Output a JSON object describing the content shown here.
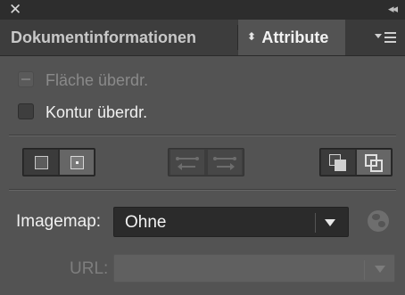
{
  "window": {
    "close_glyph": "✕",
    "collapse_glyph": "◂◂"
  },
  "tabs": [
    {
      "label": "Dokumentinformationen",
      "active": false
    },
    {
      "label": "Attribute",
      "active": true,
      "stepper_glyph": "⬍"
    }
  ],
  "panel_menu_icon": "panel-menu-icon",
  "checkboxes": {
    "fill_overprint": {
      "label": "Fläche überdr.",
      "enabled": false,
      "state": "mixed"
    },
    "stroke_overprint": {
      "label": "Kontur überdr.",
      "enabled": true,
      "checked": false
    }
  },
  "button_groups": {
    "center_mark": [
      "hide-center-icon",
      "show-center-icon"
    ],
    "direction": [
      "reverse-path-direction-off-icon",
      "reverse-path-direction-on-icon"
    ],
    "fill_rule": [
      "nonzero-winding-fill-rule-icon",
      "even-odd-fill-rule-icon"
    ]
  },
  "imagemap": {
    "label": "Imagemap:",
    "value": "Ohne"
  },
  "url": {
    "label": "URL:",
    "value": "",
    "enabled": false
  },
  "colors": {
    "panel_bg": "#535353",
    "tab_bar_bg": "#3a3a3a",
    "text_active": "#f0f0f0",
    "text_disabled": "#8a8a8a"
  }
}
